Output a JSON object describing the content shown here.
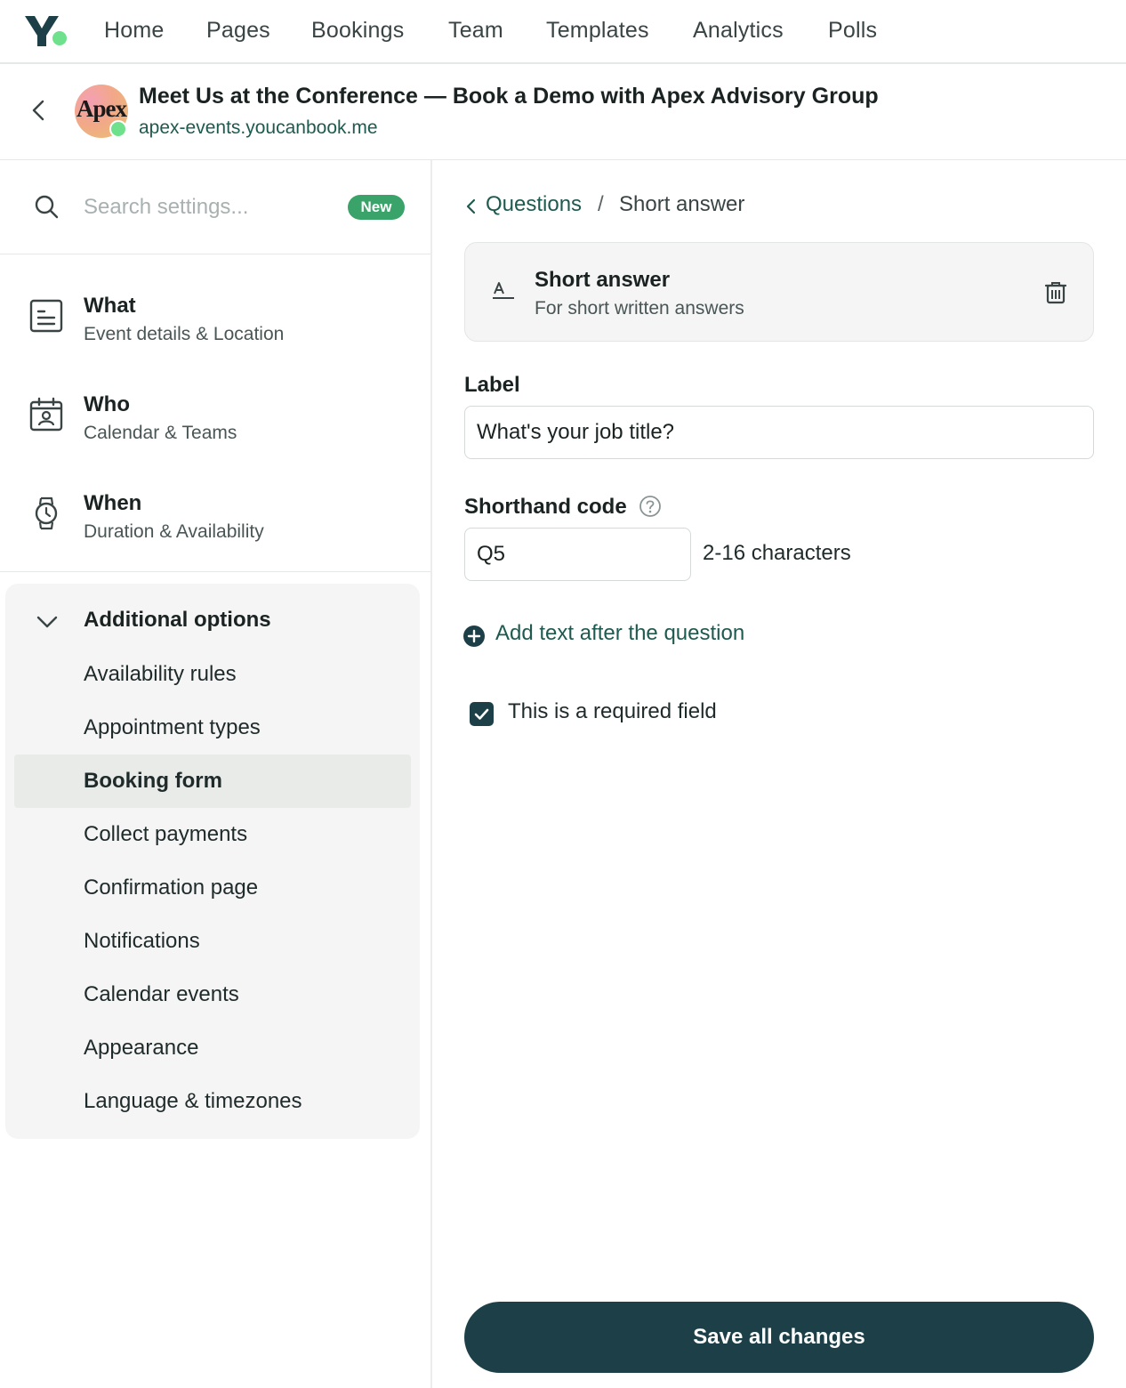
{
  "nav": {
    "items": [
      "Home",
      "Pages",
      "Bookings",
      "Team",
      "Templates",
      "Analytics",
      "Polls"
    ],
    "logo_icon": "youcanbook-logo-icon",
    "accent_color": "#6fe08c"
  },
  "header": {
    "title": "Meet Us at the Conference — Book a Demo with Apex Advisory Group",
    "url": "apex-events.youcanbook.me",
    "avatar_text": "Apex"
  },
  "sidebar": {
    "search_placeholder": "Search settings...",
    "search_badge": "New",
    "sections": [
      {
        "title": "What",
        "subtitle": "Event details & Location",
        "icon": "document-icon"
      },
      {
        "title": "Who",
        "subtitle": "Calendar & Teams",
        "icon": "calendar-person-icon"
      },
      {
        "title": "When",
        "subtitle": "Duration & Availability",
        "icon": "watch-icon"
      }
    ],
    "additional": {
      "title": "Additional options",
      "items": [
        "Availability rules",
        "Appointment types",
        "Booking form",
        "Collect payments",
        "Confirmation page",
        "Notifications",
        "Calendar events",
        "Appearance",
        "Language & timezones"
      ],
      "active": "Booking form"
    }
  },
  "main": {
    "breadcrumb": {
      "parent": "Questions",
      "separator": "/",
      "current": "Short answer"
    },
    "question_card": {
      "title": "Short answer",
      "subtitle": "For short written answers"
    },
    "label_field": {
      "label": "Label",
      "value": "What's your job title?"
    },
    "shorthand": {
      "label": "Shorthand code",
      "value": "Q5",
      "hint": "2-16 characters"
    },
    "add_text_label": "Add text after the question",
    "required": {
      "label": "This is a required field",
      "checked": true
    },
    "save_label": "Save all changes"
  },
  "colors": {
    "primary": "#1d4048",
    "link": "#1e5a4f",
    "badge": "#3aa36a"
  }
}
